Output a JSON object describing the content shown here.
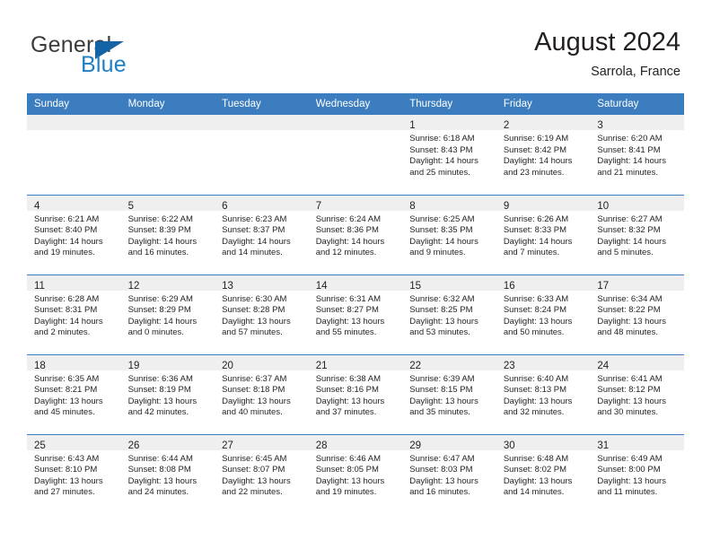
{
  "brand": {
    "name_part1": "General",
    "name_part2": "Blue",
    "logo_icon": "triangle-icon",
    "color_dark": "#3c3c3b",
    "color_blue": "#1f7fc4",
    "accent": "#3c7dbf"
  },
  "header": {
    "title": "August 2024",
    "subtitle": "Sarrola, France"
  },
  "weekday_headers": [
    "Sunday",
    "Monday",
    "Tuesday",
    "Wednesday",
    "Thursday",
    "Friday",
    "Saturday"
  ],
  "weeks": [
    [
      {
        "day": "",
        "empty": true
      },
      {
        "day": "",
        "empty": true
      },
      {
        "day": "",
        "empty": true
      },
      {
        "day": "",
        "empty": true
      },
      {
        "day": "1",
        "sunrise": "Sunrise: 6:18 AM",
        "sunset": "Sunset: 8:43 PM",
        "daylight_line1": "Daylight: 14 hours",
        "daylight_line2": "and 25 minutes."
      },
      {
        "day": "2",
        "sunrise": "Sunrise: 6:19 AM",
        "sunset": "Sunset: 8:42 PM",
        "daylight_line1": "Daylight: 14 hours",
        "daylight_line2": "and 23 minutes."
      },
      {
        "day": "3",
        "sunrise": "Sunrise: 6:20 AM",
        "sunset": "Sunset: 8:41 PM",
        "daylight_line1": "Daylight: 14 hours",
        "daylight_line2": "and 21 minutes."
      }
    ],
    [
      {
        "day": "4",
        "sunrise": "Sunrise: 6:21 AM",
        "sunset": "Sunset: 8:40 PM",
        "daylight_line1": "Daylight: 14 hours",
        "daylight_line2": "and 19 minutes."
      },
      {
        "day": "5",
        "sunrise": "Sunrise: 6:22 AM",
        "sunset": "Sunset: 8:39 PM",
        "daylight_line1": "Daylight: 14 hours",
        "daylight_line2": "and 16 minutes."
      },
      {
        "day": "6",
        "sunrise": "Sunrise: 6:23 AM",
        "sunset": "Sunset: 8:37 PM",
        "daylight_line1": "Daylight: 14 hours",
        "daylight_line2": "and 14 minutes."
      },
      {
        "day": "7",
        "sunrise": "Sunrise: 6:24 AM",
        "sunset": "Sunset: 8:36 PM",
        "daylight_line1": "Daylight: 14 hours",
        "daylight_line2": "and 12 minutes."
      },
      {
        "day": "8",
        "sunrise": "Sunrise: 6:25 AM",
        "sunset": "Sunset: 8:35 PM",
        "daylight_line1": "Daylight: 14 hours",
        "daylight_line2": "and 9 minutes."
      },
      {
        "day": "9",
        "sunrise": "Sunrise: 6:26 AM",
        "sunset": "Sunset: 8:33 PM",
        "daylight_line1": "Daylight: 14 hours",
        "daylight_line2": "and 7 minutes."
      },
      {
        "day": "10",
        "sunrise": "Sunrise: 6:27 AM",
        "sunset": "Sunset: 8:32 PM",
        "daylight_line1": "Daylight: 14 hours",
        "daylight_line2": "and 5 minutes."
      }
    ],
    [
      {
        "day": "11",
        "sunrise": "Sunrise: 6:28 AM",
        "sunset": "Sunset: 8:31 PM",
        "daylight_line1": "Daylight: 14 hours",
        "daylight_line2": "and 2 minutes."
      },
      {
        "day": "12",
        "sunrise": "Sunrise: 6:29 AM",
        "sunset": "Sunset: 8:29 PM",
        "daylight_line1": "Daylight: 14 hours",
        "daylight_line2": "and 0 minutes."
      },
      {
        "day": "13",
        "sunrise": "Sunrise: 6:30 AM",
        "sunset": "Sunset: 8:28 PM",
        "daylight_line1": "Daylight: 13 hours",
        "daylight_line2": "and 57 minutes."
      },
      {
        "day": "14",
        "sunrise": "Sunrise: 6:31 AM",
        "sunset": "Sunset: 8:27 PM",
        "daylight_line1": "Daylight: 13 hours",
        "daylight_line2": "and 55 minutes."
      },
      {
        "day": "15",
        "sunrise": "Sunrise: 6:32 AM",
        "sunset": "Sunset: 8:25 PM",
        "daylight_line1": "Daylight: 13 hours",
        "daylight_line2": "and 53 minutes."
      },
      {
        "day": "16",
        "sunrise": "Sunrise: 6:33 AM",
        "sunset": "Sunset: 8:24 PM",
        "daylight_line1": "Daylight: 13 hours",
        "daylight_line2": "and 50 minutes."
      },
      {
        "day": "17",
        "sunrise": "Sunrise: 6:34 AM",
        "sunset": "Sunset: 8:22 PM",
        "daylight_line1": "Daylight: 13 hours",
        "daylight_line2": "and 48 minutes."
      }
    ],
    [
      {
        "day": "18",
        "sunrise": "Sunrise: 6:35 AM",
        "sunset": "Sunset: 8:21 PM",
        "daylight_line1": "Daylight: 13 hours",
        "daylight_line2": "and 45 minutes."
      },
      {
        "day": "19",
        "sunrise": "Sunrise: 6:36 AM",
        "sunset": "Sunset: 8:19 PM",
        "daylight_line1": "Daylight: 13 hours",
        "daylight_line2": "and 42 minutes."
      },
      {
        "day": "20",
        "sunrise": "Sunrise: 6:37 AM",
        "sunset": "Sunset: 8:18 PM",
        "daylight_line1": "Daylight: 13 hours",
        "daylight_line2": "and 40 minutes."
      },
      {
        "day": "21",
        "sunrise": "Sunrise: 6:38 AM",
        "sunset": "Sunset: 8:16 PM",
        "daylight_line1": "Daylight: 13 hours",
        "daylight_line2": "and 37 minutes."
      },
      {
        "day": "22",
        "sunrise": "Sunrise: 6:39 AM",
        "sunset": "Sunset: 8:15 PM",
        "daylight_line1": "Daylight: 13 hours",
        "daylight_line2": "and 35 minutes."
      },
      {
        "day": "23",
        "sunrise": "Sunrise: 6:40 AM",
        "sunset": "Sunset: 8:13 PM",
        "daylight_line1": "Daylight: 13 hours",
        "daylight_line2": "and 32 minutes."
      },
      {
        "day": "24",
        "sunrise": "Sunrise: 6:41 AM",
        "sunset": "Sunset: 8:12 PM",
        "daylight_line1": "Daylight: 13 hours",
        "daylight_line2": "and 30 minutes."
      }
    ],
    [
      {
        "day": "25",
        "sunrise": "Sunrise: 6:43 AM",
        "sunset": "Sunset: 8:10 PM",
        "daylight_line1": "Daylight: 13 hours",
        "daylight_line2": "and 27 minutes."
      },
      {
        "day": "26",
        "sunrise": "Sunrise: 6:44 AM",
        "sunset": "Sunset: 8:08 PM",
        "daylight_line1": "Daylight: 13 hours",
        "daylight_line2": "and 24 minutes."
      },
      {
        "day": "27",
        "sunrise": "Sunrise: 6:45 AM",
        "sunset": "Sunset: 8:07 PM",
        "daylight_line1": "Daylight: 13 hours",
        "daylight_line2": "and 22 minutes."
      },
      {
        "day": "28",
        "sunrise": "Sunrise: 6:46 AM",
        "sunset": "Sunset: 8:05 PM",
        "daylight_line1": "Daylight: 13 hours",
        "daylight_line2": "and 19 minutes."
      },
      {
        "day": "29",
        "sunrise": "Sunrise: 6:47 AM",
        "sunset": "Sunset: 8:03 PM",
        "daylight_line1": "Daylight: 13 hours",
        "daylight_line2": "and 16 minutes."
      },
      {
        "day": "30",
        "sunrise": "Sunrise: 6:48 AM",
        "sunset": "Sunset: 8:02 PM",
        "daylight_line1": "Daylight: 13 hours",
        "daylight_line2": "and 14 minutes."
      },
      {
        "day": "31",
        "sunrise": "Sunrise: 6:49 AM",
        "sunset": "Sunset: 8:00 PM",
        "daylight_line1": "Daylight: 13 hours",
        "daylight_line2": "and 11 minutes."
      }
    ]
  ]
}
